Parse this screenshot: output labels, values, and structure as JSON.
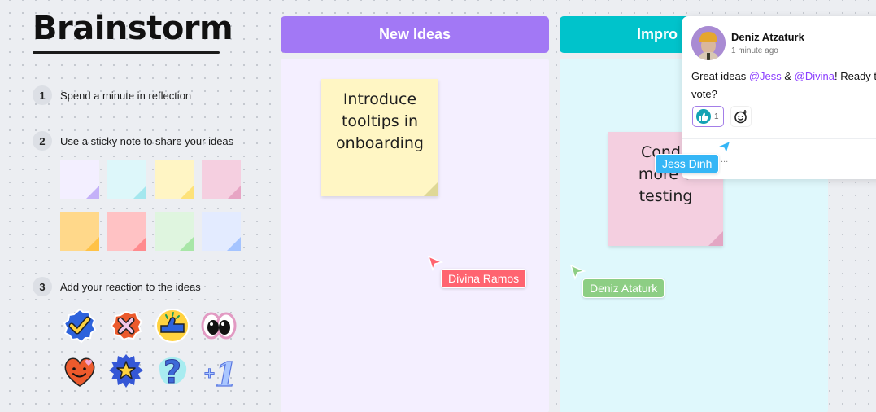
{
  "board": {
    "title": "Brainstorm",
    "steps": [
      {
        "number": "1",
        "label": "Spend a minute in reflection"
      },
      {
        "number": "2",
        "label": "Use a sticky note to share your ideas"
      },
      {
        "number": "3",
        "label": "Add your reaction to the ideas"
      }
    ],
    "sticky_colors": [
      {
        "name": "lavender",
        "fill": "#f3efff",
        "fold": "#c4b1f8"
      },
      {
        "name": "aqua",
        "fill": "#ddf7fa",
        "fold": "#a4e7ee"
      },
      {
        "name": "yellow",
        "fill": "#fff5c4",
        "fold": "#fde27a"
      },
      {
        "name": "pink",
        "fill": "#f5cfe0",
        "fold": "#e7a5c4"
      },
      {
        "name": "orange",
        "fill": "#ffd88a",
        "fold": "#ffc246"
      },
      {
        "name": "coral",
        "fill": "#ffc2c4",
        "fold": "#ff8b8e"
      },
      {
        "name": "mint",
        "fill": "#dff5df",
        "fold": "#a8e6a7"
      },
      {
        "name": "periwinkle",
        "fill": "#e3ebff",
        "fold": "#a5c4ff"
      }
    ],
    "reactions": [
      "check-badge",
      "cross-badge",
      "thumbs-up",
      "eyes",
      "smiling-heart",
      "star-badge",
      "question-mark",
      "plus-one"
    ]
  },
  "columns": [
    {
      "title": "New Ideas",
      "header_color": "#a278f5",
      "body_color": "#f4efff"
    },
    {
      "title": "Impro",
      "header_color": "#00c3cb",
      "body_color": "#dff8fc"
    }
  ],
  "notes": [
    {
      "text_lines": [
        "Introduce",
        "tooltips in",
        "onboarding"
      ],
      "fill": "#fff6c4",
      "fold": "#dfd896"
    },
    {
      "text_lines": [
        "Condu",
        "more u",
        "testing"
      ],
      "fill": "#f4cfe0",
      "fold": "#e3a6c3"
    }
  ],
  "cursors": [
    {
      "name": "Divina Ramos",
      "color": "#ff6470"
    },
    {
      "name": "Deniz Ataturk",
      "color": "#8dce84"
    },
    {
      "name": "Jess Dinh",
      "color": "#35b6f6"
    }
  ],
  "comment": {
    "author": "Deniz Atzaturk",
    "time": "1 minute ago",
    "text_before": "Great ideas ",
    "mention1": "@Jess",
    "text_mid": " & ",
    "mention2": "@Divina",
    "text_after": "! Ready to vote?",
    "reaction_icon": "thumbs-up-icon",
    "reaction_count": "1",
    "typing": "..."
  }
}
